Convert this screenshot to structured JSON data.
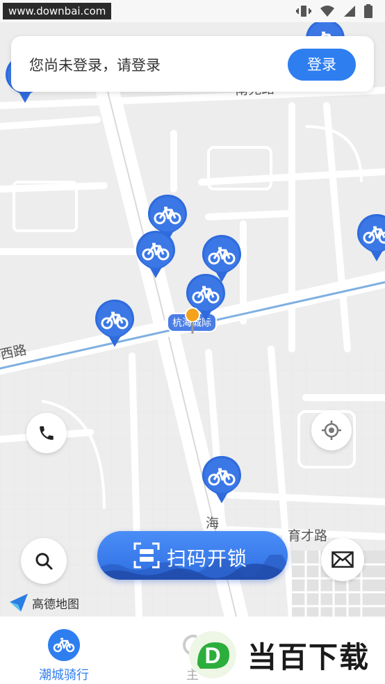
{
  "status_bar": {
    "watermark": "www.downbai.com"
  },
  "login": {
    "prompt": "您尚未登录，请登录",
    "button": "登录"
  },
  "map": {
    "road_labels": [
      "南苑路",
      "西路",
      "海",
      "育才路",
      "杭海城际"
    ],
    "bike_count": 8,
    "attribution": "高德地图"
  },
  "actions": {
    "scan": "扫码开锁"
  },
  "bottom_nav": {
    "items": [
      {
        "label": "潮城骑行",
        "active": true
      },
      {
        "label": "主",
        "active": false
      }
    ]
  },
  "watermark_bottom": {
    "text": "当百下载",
    "letter": "D"
  },
  "colors": {
    "primary": "#2e7ef0",
    "pin": "#3b74e0",
    "location": "#f3a21a"
  }
}
